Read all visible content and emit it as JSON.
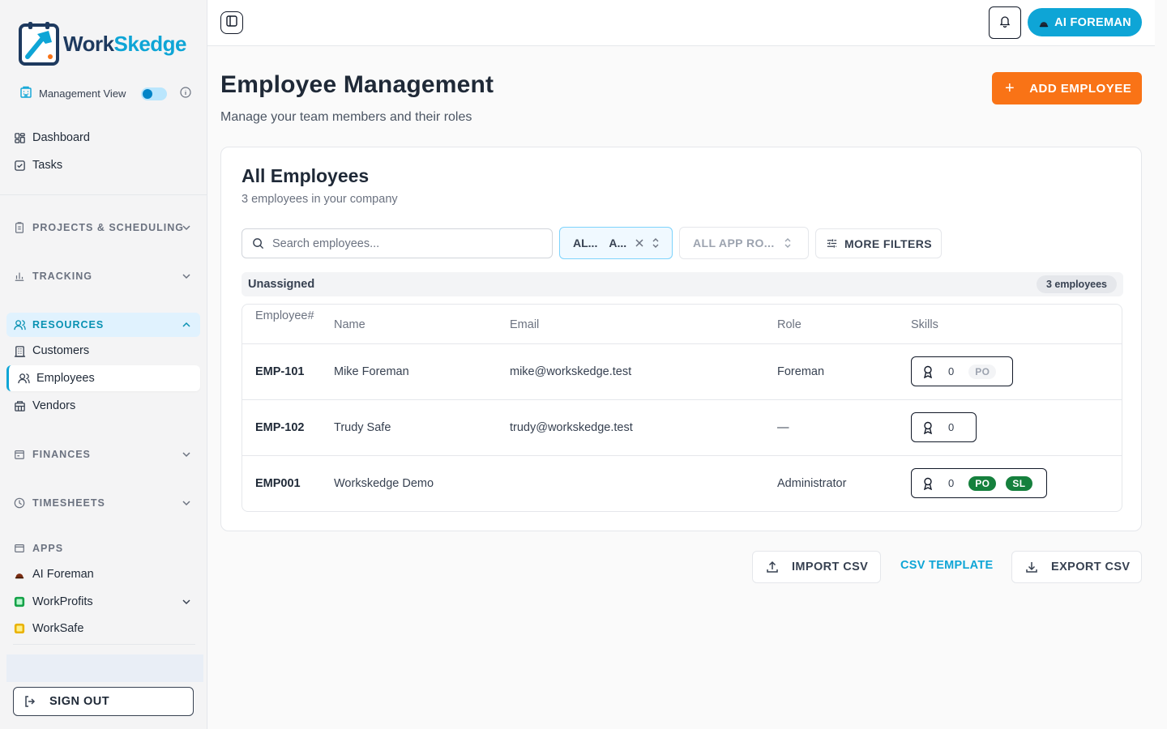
{
  "brand": {
    "name_part1": "Work",
    "name_part2": "Skedge"
  },
  "sidebar": {
    "management_view": "Management View",
    "top_items": [
      {
        "label": "Dashboard",
        "icon": "dashboard-icon"
      },
      {
        "label": "Tasks",
        "icon": "tasks-icon"
      }
    ],
    "sections": {
      "projects": "PROJECTS & SCHEDULING",
      "tracking": "TRACKING",
      "resources": "RESOURCES",
      "finances": "FINANCES",
      "timesheets": "TIMESHEETS",
      "apps": "APPS"
    },
    "resource_items": [
      {
        "label": "Customers"
      },
      {
        "label": "Employees",
        "active": true
      },
      {
        "label": "Vendors"
      }
    ],
    "app_items": [
      {
        "label": "AI Foreman"
      },
      {
        "label": "WorkProfits"
      },
      {
        "label": "WorkSafe"
      }
    ],
    "sign_out": "SIGN OUT"
  },
  "topbar": {
    "ai_button": "AI FOREMAN"
  },
  "page": {
    "title": "Employee Management",
    "subtitle": "Manage your team members and their roles",
    "add_button": "ADD EMPLOYEE"
  },
  "card": {
    "title": "All Employees",
    "subtitle": "3 employees in your company",
    "search_placeholder": "Search employees...",
    "filter1_part1": "AL...",
    "filter1_part2": "A...",
    "filter2": "ALL APP RO...",
    "more_filters": "MORE FILTERS",
    "group_label": "Unassigned",
    "group_count": "3 employees",
    "columns": {
      "employee_number_1": "Employee",
      "employee_number_2": "#",
      "name": "Name",
      "email": "Email",
      "role": "Role",
      "skills": "Skills"
    },
    "rows": [
      {
        "id": "EMP-101",
        "name": "Mike Foreman",
        "email": "mike@workskedge.test",
        "role": "Foreman",
        "skill_count": "0",
        "chips": [
          "PO"
        ]
      },
      {
        "id": "EMP-102",
        "name": "Trudy Safe",
        "email": "trudy@workskedge.test",
        "role": "—",
        "skill_count": "0",
        "chips": []
      },
      {
        "id": "EMP001",
        "name": "Workskedge Demo",
        "email": "",
        "role": "Administrator",
        "skill_count": "0",
        "chips": [
          "PO",
          "SL"
        ]
      }
    ]
  },
  "actions": {
    "import": "IMPORT CSV",
    "template": "CSV TEMPLATE",
    "export": "EXPORT CSV"
  },
  "colors": {
    "accent": "#0ea5d6",
    "primary_action": "#f97316",
    "skill_chip_active": "#15803d"
  }
}
